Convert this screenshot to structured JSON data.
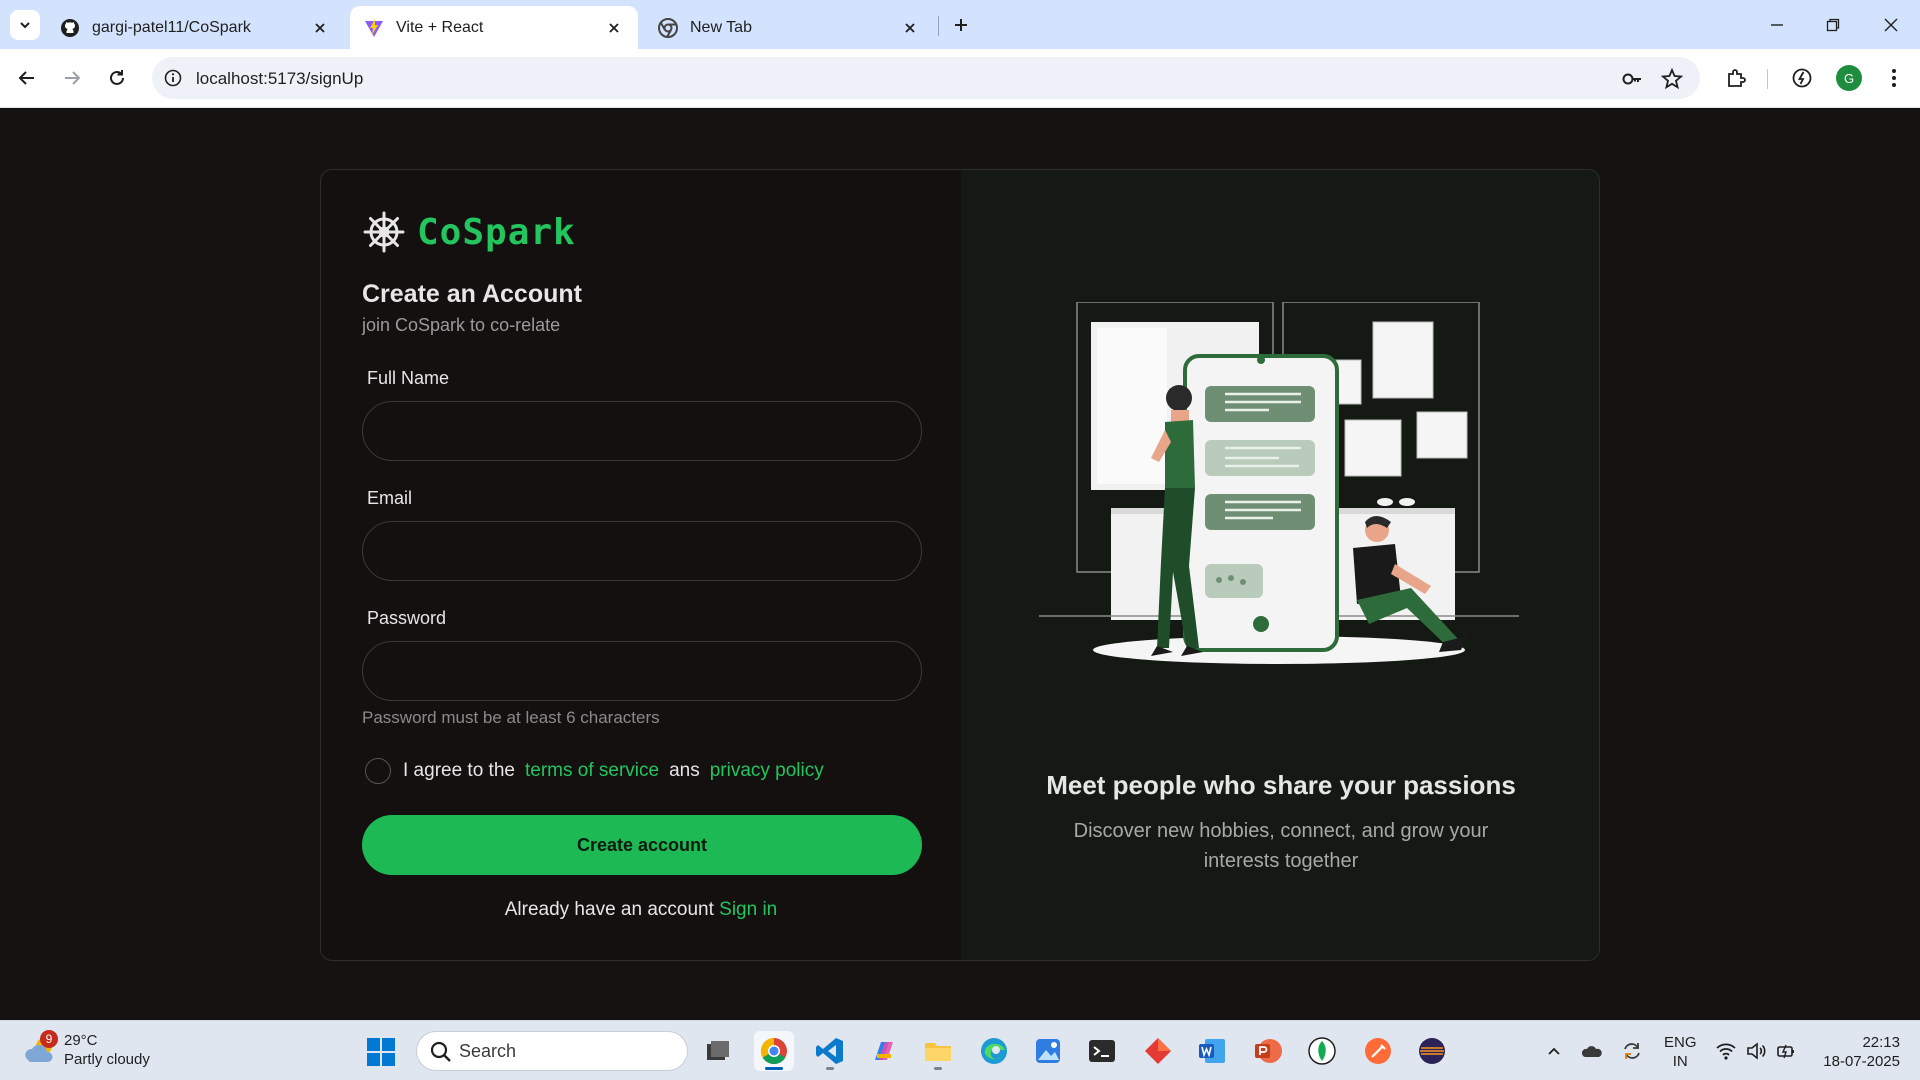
{
  "browser": {
    "tabs": [
      {
        "title": "gargi-patel11/CoSpark",
        "icon": "github-icon"
      },
      {
        "title": "Vite + React",
        "icon": "vite-icon"
      },
      {
        "title": "New Tab",
        "icon": "chrome-icon"
      }
    ],
    "url": "localhost:5173/signUp",
    "profile_initial": "G"
  },
  "page": {
    "brand": "CoSpark",
    "heading": "Create an Account",
    "subheading": "join CoSpark to co-relate",
    "fields": {
      "full_name": {
        "label": "Full Name",
        "value": ""
      },
      "email": {
        "label": "Email",
        "value": ""
      },
      "password": {
        "label": "Password",
        "value": ""
      }
    },
    "password_hint": "Password must be at least 6 characters",
    "agree": {
      "prefix": "I agree to the",
      "terms": "terms of service",
      "joiner": "ans",
      "privacy": "privacy policy"
    },
    "submit_label": "Create account",
    "signin_prompt": "Already have an account",
    "signin_link": "Sign in",
    "promo_title": "Meet people who share your passions",
    "promo_text": "Discover new hobbies, connect, and grow your interests together",
    "accent": "#22c55e"
  },
  "taskbar": {
    "weather_temp": "29°C",
    "weather_desc": "Partly cloudy",
    "weather_badge": "9",
    "search_placeholder": "Search",
    "lang_primary": "ENG",
    "lang_secondary": "IN",
    "time": "22:13",
    "date": "18-07-2025"
  }
}
